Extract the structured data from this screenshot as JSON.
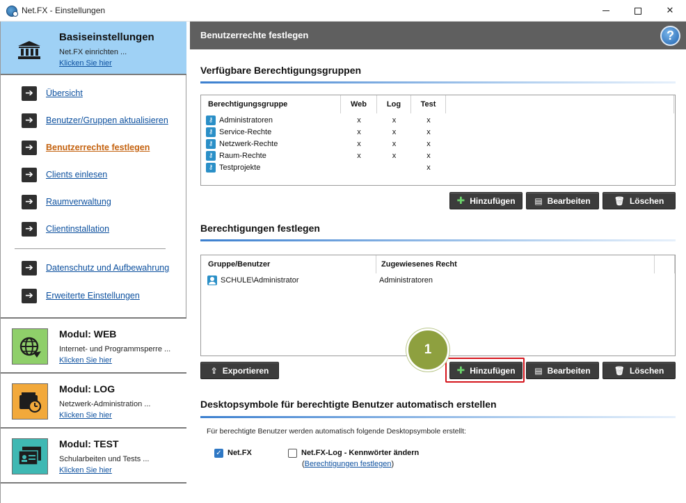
{
  "window": {
    "title": "Net.FX - Einstellungen"
  },
  "sidebar": {
    "basis": {
      "title": "Basiseinstellungen",
      "subtitle": "Net.FX einrichten ...",
      "link": "Klicken Sie hier"
    },
    "nav_items": [
      {
        "label": "Übersicht"
      },
      {
        "label": "Benutzer/Gruppen aktualisieren"
      },
      {
        "label": "Benutzerrechte festlegen",
        "active": true
      },
      {
        "label": "Clients einlesen"
      },
      {
        "label": "Raumverwaltung"
      },
      {
        "label": "Clientinstallation"
      },
      {
        "label": "Datenschutz und Aufbewahrung"
      },
      {
        "label": "Erweiterte Einstellungen"
      }
    ],
    "modules": [
      {
        "title": "Modul: WEB",
        "subtitle": "Internet- und Programmsperre ...",
        "link": "Klicken Sie hier",
        "icon": "globe-icon",
        "color": "#8fcf6a"
      },
      {
        "title": "Modul: LOG",
        "subtitle": "Netzwerk-Administration ...",
        "link": "Klicken Sie hier",
        "icon": "log-clock-icon",
        "color": "#f2a93b"
      },
      {
        "title": "Modul: TEST",
        "subtitle": "Schularbeiten und Tests ...",
        "link": "Klicken Sie hier",
        "icon": "test-folder-icon",
        "color": "#3fb8b3"
      }
    ]
  },
  "main": {
    "header_title": "Benutzerrechte festlegen",
    "help_label": "?",
    "groups_section": {
      "title": "Verfügbare Berechtigungsgruppen",
      "columns": [
        "Berechtigungsgruppe",
        "Web",
        "Log",
        "Test"
      ],
      "rows": [
        {
          "name": "Administratoren",
          "web": "x",
          "log": "x",
          "test": "x"
        },
        {
          "name": "Service-Rechte",
          "web": "x",
          "log": "x",
          "test": "x"
        },
        {
          "name": "Netzwerk-Rechte",
          "web": "x",
          "log": "x",
          "test": "x"
        },
        {
          "name": "Raum-Rechte",
          "web": "x",
          "log": "x",
          "test": "x"
        },
        {
          "name": "Testprojekte",
          "web": "",
          "log": "",
          "test": "x"
        }
      ],
      "buttons": {
        "add": "Hinzufügen",
        "edit": "Bearbeiten",
        "delete": "Löschen"
      }
    },
    "rights_section": {
      "title": "Berechtigungen festlegen",
      "columns": [
        "Gruppe/Benutzer",
        "Zugewiesenes Recht"
      ],
      "rows": [
        {
          "user": "SCHULE\\Administrator",
          "right": "Administratoren"
        }
      ],
      "buttons": {
        "export": "Exportieren",
        "add": "Hinzufügen",
        "edit": "Bearbeiten",
        "delete": "Löschen"
      },
      "step_marker": "1"
    },
    "desktop_section": {
      "title": "Desktopsymbole für berechtigte Benutzer automatisch erstellen",
      "description": "Für berechtigte Benutzer werden automatisch folgende Desktopsymbole erstellt:",
      "options": [
        {
          "label": "Net.FX",
          "checked": true
        },
        {
          "label": "Net.FX-Log - Kennwörter ändern",
          "checked": false
        }
      ],
      "link_prefix": "(",
      "link": "Berechtigungen festlegen",
      "link_suffix": ")"
    }
  }
}
